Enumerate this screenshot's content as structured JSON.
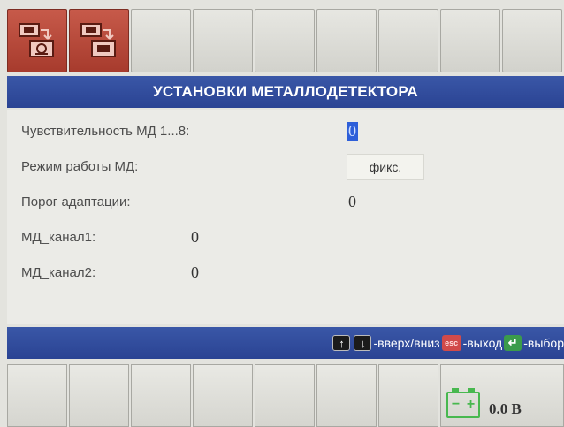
{
  "title": "УСТАНОВКИ МЕТАЛЛОДЕТЕКТОРА",
  "settings": [
    {
      "label": "Чувствительность МД 1...8:",
      "value": "0"
    },
    {
      "label": "Режим работы МД:",
      "value": "фикс."
    },
    {
      "label": "Порог адаптации:",
      "value": "0"
    },
    {
      "label": "МД_канал1:",
      "value": "0"
    },
    {
      "label": "МД_канал2:",
      "value": "0"
    }
  ],
  "help": {
    "updown": "-вверх/вниз",
    "exit": "-выход",
    "select": "-выбор",
    "esc_key": "esc"
  },
  "status": {
    "voltage": "0.0 В"
  },
  "colors": {
    "title_bar": "#2f4a9b",
    "active_key": "#b54837",
    "selection": "#2e5fd9",
    "battery": "#48b84f"
  },
  "icons": {
    "key1": "metal-detector-settings-icon",
    "key2": "metal-detector-channel-icon"
  }
}
